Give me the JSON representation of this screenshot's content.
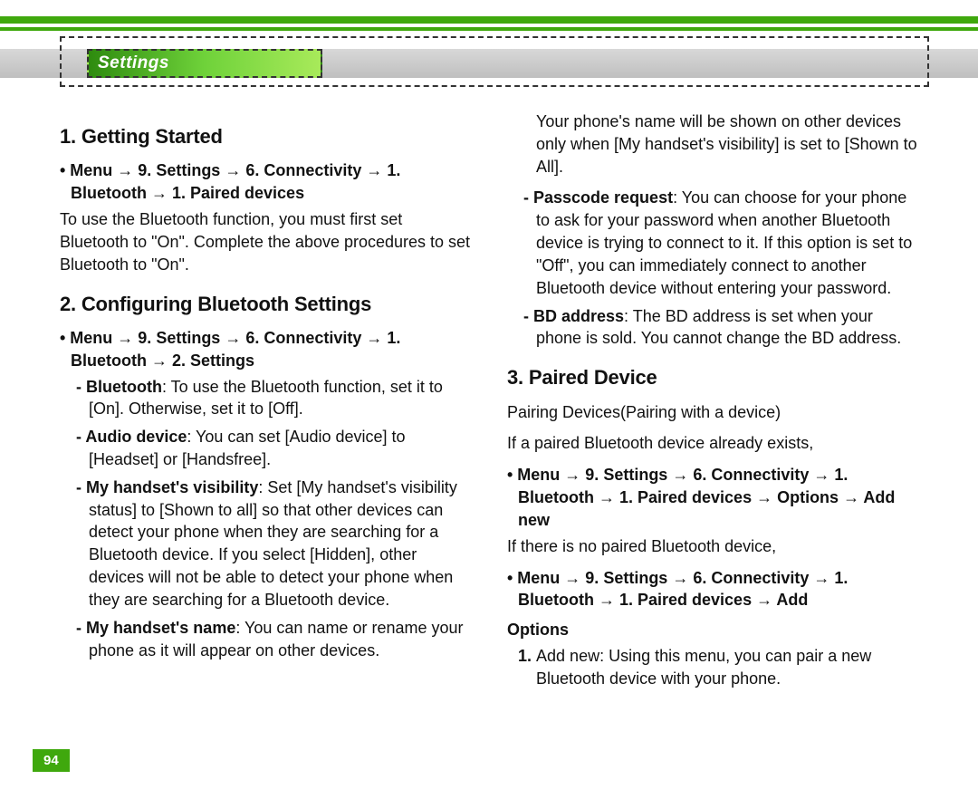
{
  "header": {
    "tab_label": "Settings"
  },
  "page_number": "94",
  "left": {
    "s1_title": "1. Getting Started",
    "s1_path": "• Menu → 9. Settings → 6. Connectivity → 1. Bluetooth → 1. Paired devices",
    "s1_body": "To use the Bluetooth function, you must first set Bluetooth to \"On\". Complete the above procedures to set Bluetooth to \"On\".",
    "s2_title": "2. Configuring Bluetooth Settings",
    "s2_path": "• Menu → 9. Settings → 6. Connectivity → 1. Bluetooth → 2. Settings",
    "s2_i1_lead": "Bluetooth",
    "s2_i1_body": ": To use the Bluetooth function, set it to [On]. Otherwise, set it to [Off].",
    "s2_i2_lead": "Audio device",
    "s2_i2_body": ": You can set [Audio device] to [Headset] or [Handsfree].",
    "s2_i3_lead": "My handset's visibility",
    "s2_i3_body": ": Set [My handset's visibility status] to [Shown to all] so that other devices can detect your phone when they are searching for a Bluetooth device. If you select [Hidden], other devices will not be able to detect your phone when they are searching for a Bluetooth device.",
    "s2_i4_lead": "My handset's name",
    "s2_i4_body": ": You can name or rename your phone as it will appear on other devices."
  },
  "right": {
    "top_para": "Your phone's name will be shown on other devices only when [My handset's visibility] is set to [Shown to All].",
    "r_i1_lead": "Passcode request",
    "r_i1_body": ": You can choose for your phone to ask for your password when another Bluetooth device is trying to connect to it. If this option is set to \"Off\", you can immediately connect to another Bluetooth device without entering your password.",
    "r_i2_lead": "BD address",
    "r_i2_body": ": The BD address is set when your phone is sold. You cannot change the BD address.",
    "s3_title": "3. Paired Device",
    "s3_l1": "Pairing Devices(Pairing with a device)",
    "s3_l2": "If a paired Bluetooth device already exists,",
    "s3_path1": "• Menu → 9. Settings → 6. Connectivity → 1. Bluetooth → 1. Paired devices → Options → Add new",
    "s3_l3": "If there is no paired Bluetooth device,",
    "s3_path2": "• Menu → 9. Settings → 6. Connectivity → 1. Bluetooth → 1. Paired devices → Add",
    "options_label": "Options",
    "opt1_num": "1",
    "opt1_lead": "Add new",
    "opt1_body": ": Using this menu, you can pair a new Bluetooth device with your phone."
  }
}
